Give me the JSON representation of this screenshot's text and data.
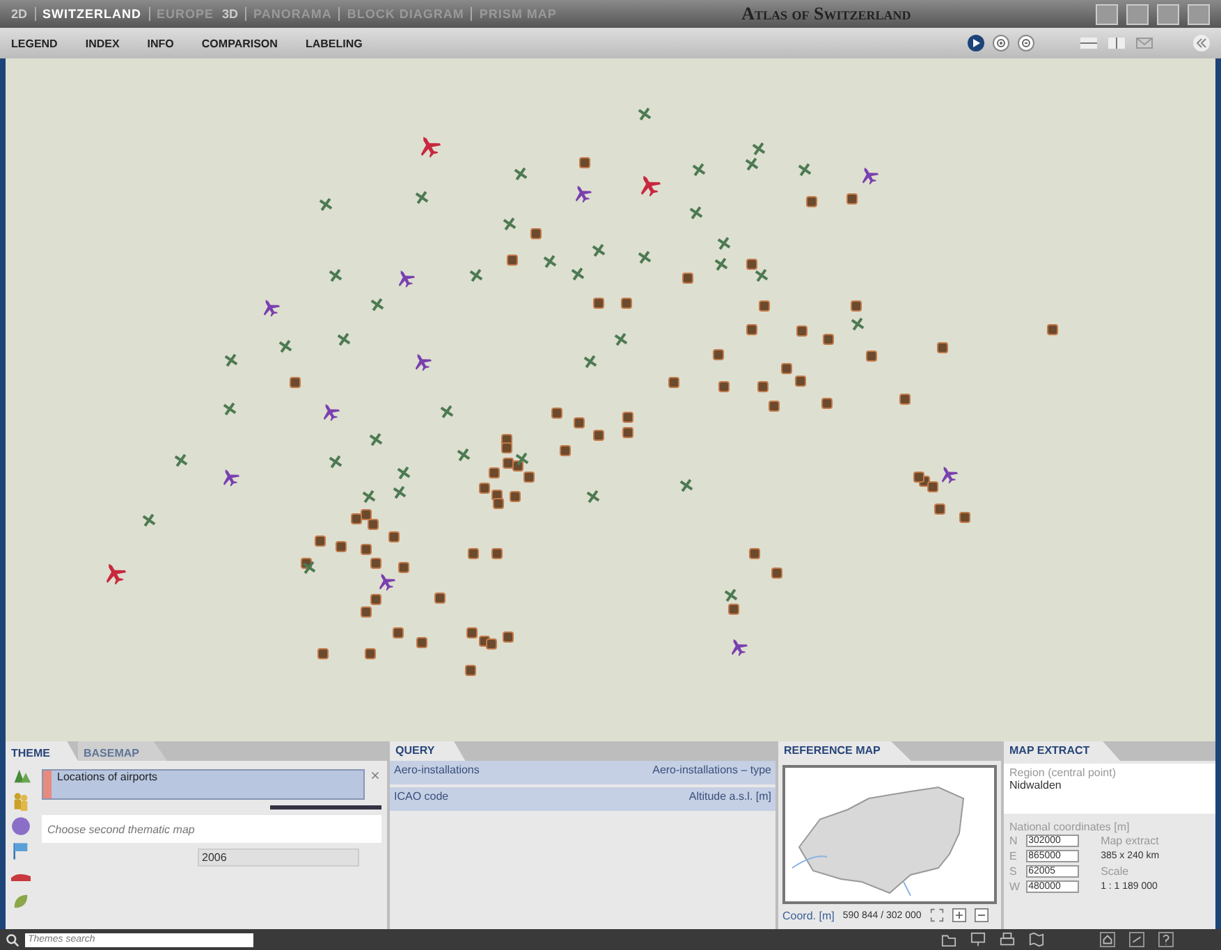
{
  "window": {
    "title": "Atlas of Switzerland"
  },
  "view_groups": [
    {
      "label": "2D",
      "items": [
        {
          "label": "SWITZERLAND",
          "selected": true
        },
        {
          "label": "EUROPE",
          "selected": false
        }
      ]
    },
    {
      "label": "3D",
      "items": [
        {
          "label": "PANORAMA",
          "selected": false
        },
        {
          "label": "BLOCK DIAGRAM",
          "selected": false
        },
        {
          "label": "PRISM MAP",
          "selected": false
        }
      ]
    }
  ],
  "menu": [
    "LEGEND",
    "INDEX",
    "INFO",
    "COMPARISON",
    "LABELING"
  ],
  "theme_panel": {
    "tabs": [
      {
        "label": "THEME",
        "selected": true
      },
      {
        "label": "BASEMAP",
        "selected": false
      }
    ],
    "layer": "Locations of airports",
    "layer_slider": {
      "level": 1
    },
    "second_layer": {
      "placeholder": "Choose second thematic map"
    },
    "year": "2006"
  },
  "query_panel": {
    "title": "QUERY",
    "rows": [
      {
        "label": "Aero-installations",
        "value": "Aero-installations – type"
      },
      {
        "label": "ICAO code",
        "value": "Altitude a.s.l. [m]"
      }
    ]
  },
  "reference_map": {
    "title": "REFERENCE MAP",
    "coord_label": "Coord. [m]",
    "coord_value": "590 844 / 302 000"
  },
  "map_extract": {
    "title": "MAP EXTRACT",
    "region_label": "Region (central point)",
    "region": "Nidwalden",
    "coords_label": "National coordinates [m]",
    "coords": [
      {
        "label": "N",
        "value": "302000"
      },
      {
        "label": "E",
        "value": "865000"
      },
      {
        "label": "S",
        "value": "62005"
      },
      {
        "label": "W",
        "value": "480000"
      }
    ],
    "extract_label": "Map extract",
    "extract_value": "385 x 240 km",
    "scale_label": "Scale",
    "scale_value": "1 : 1 189 000"
  },
  "search": {
    "placeholder": "Themes search"
  }
}
